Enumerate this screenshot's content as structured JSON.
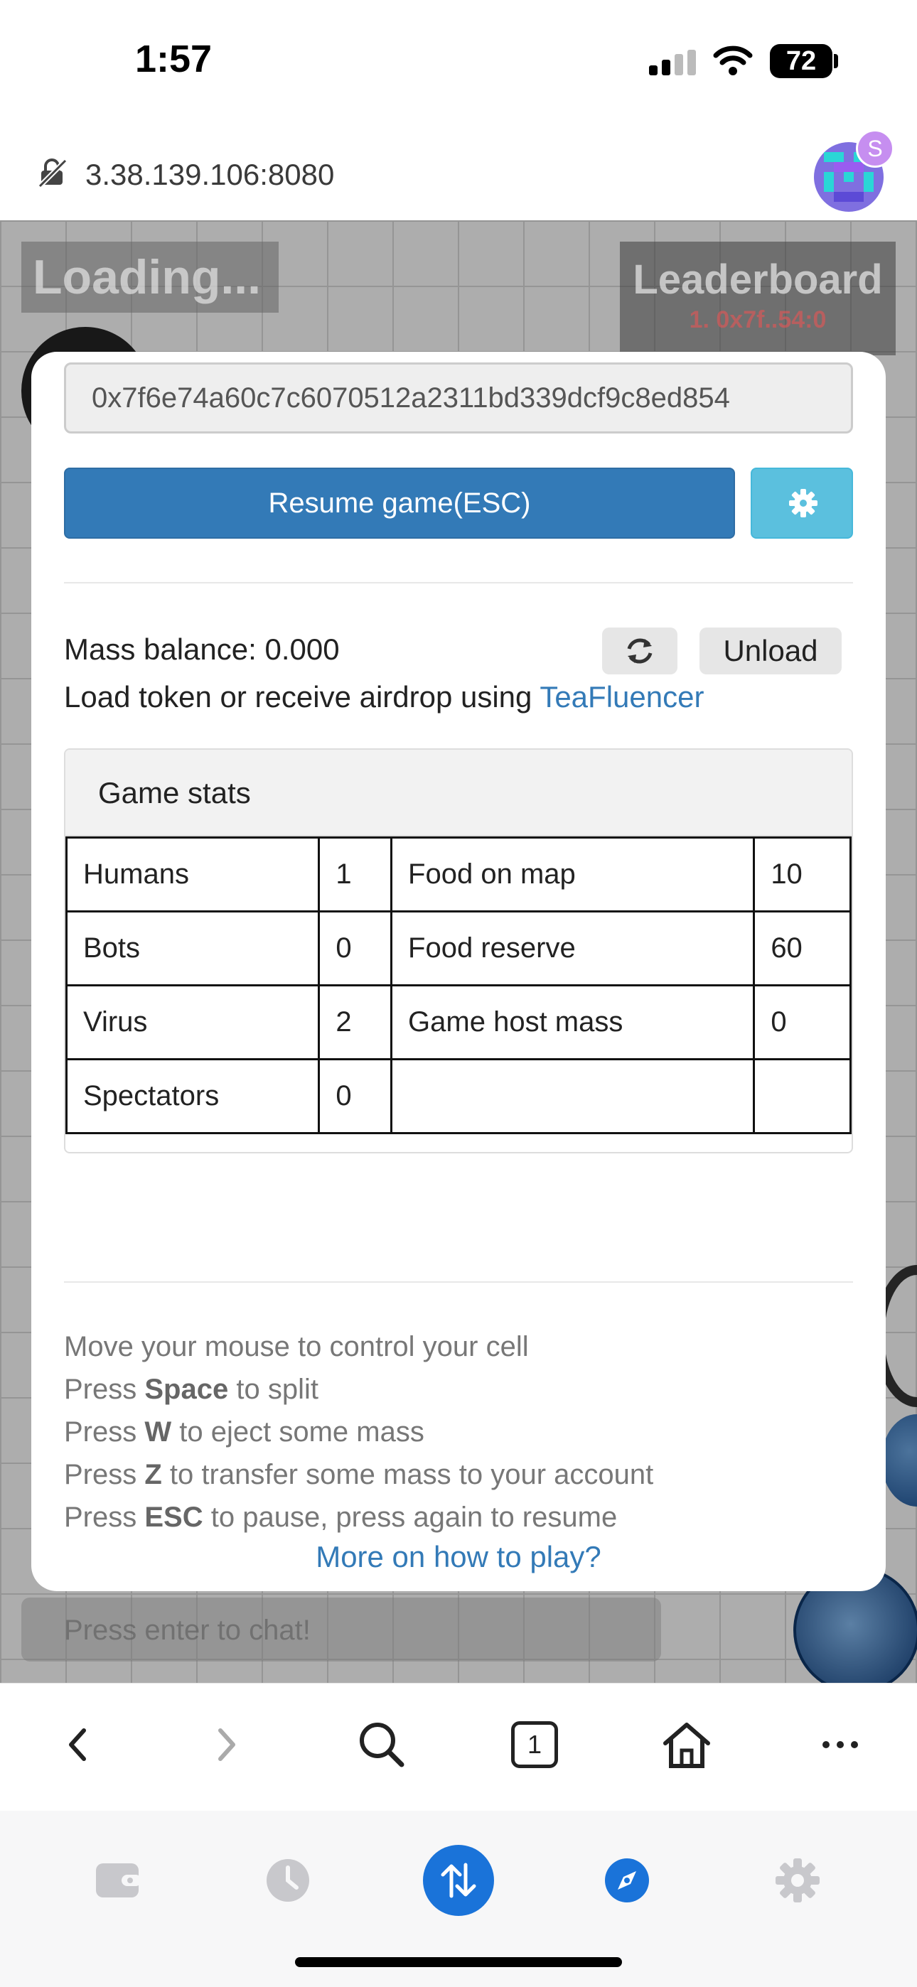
{
  "status_bar": {
    "time": "1:57",
    "battery": "72"
  },
  "browser": {
    "url": "3.38.139.106:8080",
    "avatar_badge": "S"
  },
  "game": {
    "loading_text": "Loading...",
    "leaderboard_title": "Leaderboard",
    "leaderboard_entry": "1. 0x7f..54:0",
    "chat_placeholder": "Press enter to chat!"
  },
  "modal": {
    "address": "0x7f6e74a60c7c6070512a2311bd339dcf9c8ed854",
    "resume_label": "Resume game(ESC)",
    "mass_balance": "Mass balance: 0.000",
    "unload_label": "Unload",
    "airdrop_prefix": "Load token or receive airdrop using ",
    "airdrop_link": "TeaFluencer",
    "stats_heading": "Game stats",
    "stats": [
      [
        "Humans",
        "1",
        "Food on map",
        "10"
      ],
      [
        "Bots",
        "0",
        "Food reserve",
        "60"
      ],
      [
        "Virus",
        "2",
        "Game host mass",
        "0"
      ],
      [
        "Spectators",
        "0",
        "",
        ""
      ]
    ],
    "help": {
      "line1": "Move your mouse to control your cell",
      "press": "Press",
      "space_key": "Space",
      "space_text": " to split",
      "w_key": "W",
      "w_text": " to eject some mass",
      "z_key": "Z",
      "z_text": " to transfer some mass to your account",
      "esc_key": "ESC",
      "esc_text": " to pause, press again to resume"
    },
    "more_link": "More on how to play?"
  },
  "nav_bar": {
    "tab_count": "1"
  },
  "colors": {
    "primary": "#337ab7",
    "info": "#5bc0de",
    "tab_active": "#1a73d9"
  }
}
